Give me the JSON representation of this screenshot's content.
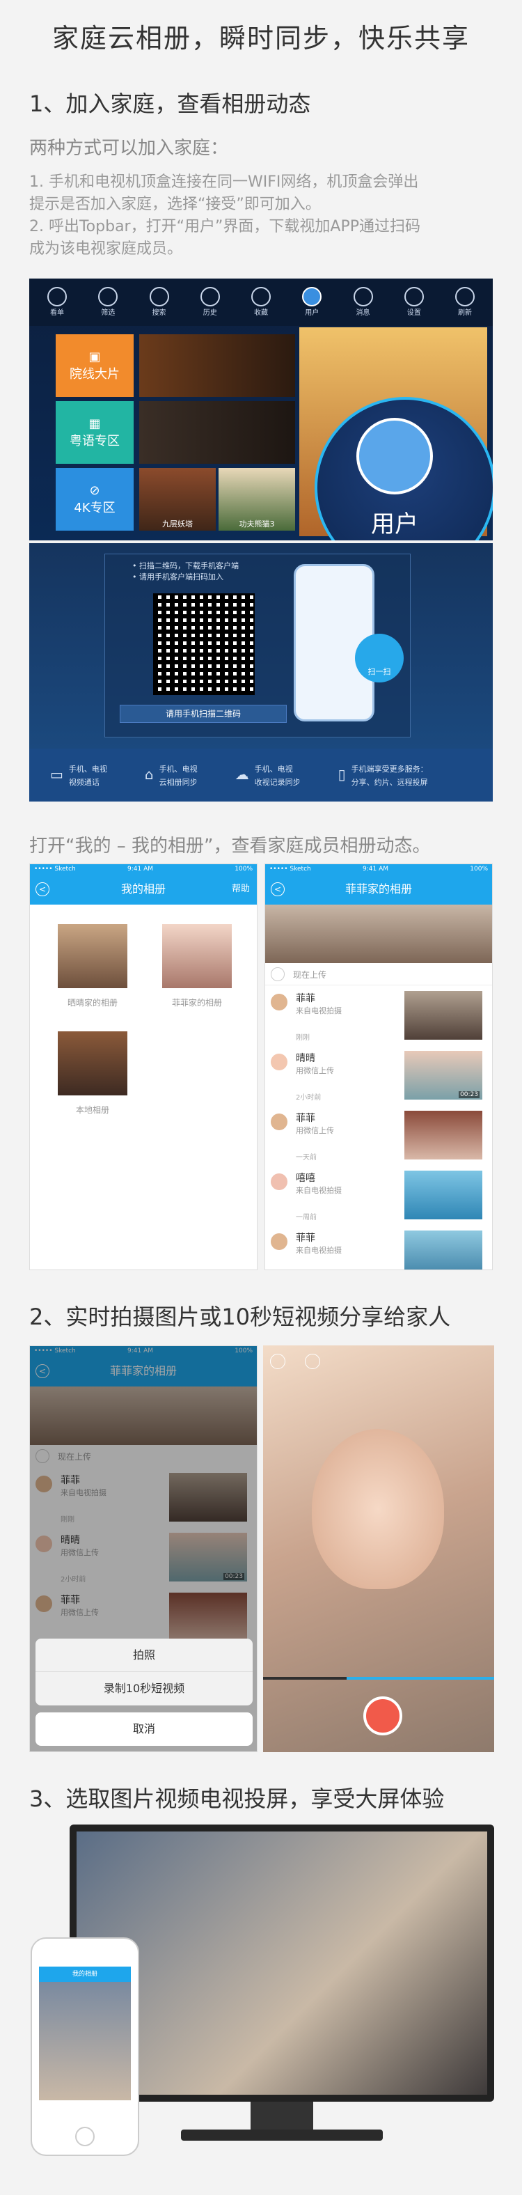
{
  "page_title": "家庭云相册，瞬时同步，快乐共享",
  "section1": {
    "title": "1、加入家庭，查看相册动态",
    "subtitle": "两种方式可以加入家庭：",
    "line1": "1. 手机和电视机顶盒连接在同一WIFI网络，机顶盒会弹出",
    "line2": "提示是否加入家庭，选择“接受”即可加入。",
    "line3": "2. 呼出Topbar，打开“用户”界面，下载视加APP通过扫码",
    "line4": "成为该电视家庭成员。",
    "tv_menu": [
      "看单",
      "筛选",
      "搜索",
      "历史",
      "收藏",
      "用户",
      "消息",
      "设置",
      "刷新"
    ],
    "tiles": [
      "院线大片",
      "粤语专区",
      "4K专区"
    ],
    "poster_captions": [
      "九层妖塔",
      "功夫熊猫3"
    ],
    "user_label": "用户",
    "qr_tip1": "• 扫描二维码，下载手机客户端",
    "qr_tip2": "• 请用手机客户端扫码加入",
    "qr_button": "请用手机扫描二维码",
    "scan_label": "扫一扫",
    "features": [
      {
        "a": "手机、电视",
        "b": "视频通话"
      },
      {
        "a": "手机、电视",
        "b": "云相册同步"
      },
      {
        "a": "手机、电视",
        "b": "收视记录同步"
      },
      {
        "a": "手机端享受更多服务：",
        "b": "分享、约片、远程投屏"
      }
    ]
  },
  "section1b": {
    "caption": "打开“我的 – 我的相册”，查看家庭成员相册动态。",
    "left_phone": {
      "status": "••••• Sketch",
      "time": "9:41 AM",
      "battery": "100%",
      "title": "我的相册",
      "help": "帮助",
      "albums": [
        "晒晴家的相册",
        "菲菲家的相册",
        "本地相册"
      ]
    },
    "right_phone": {
      "status": "••••• Sketch",
      "time": "9:41 AM",
      "battery": "100%",
      "title": "菲菲家的相册",
      "now_upload": "现在上传",
      "items": [
        {
          "name": "菲菲",
          "src": "来自电视拍摄",
          "time": "刚刚"
        },
        {
          "name": "晴晴",
          "src": "用微信上传",
          "time": "2小时前",
          "dur": "00:23"
        },
        {
          "name": "菲菲",
          "src": "用微信上传",
          "time": "一天前"
        },
        {
          "name": "嘻嘻",
          "src": "来自电视拍摄",
          "time": "一周前"
        },
        {
          "name": "菲菲",
          "src": "来自电视拍摄",
          "time": ""
        }
      ]
    }
  },
  "section2": {
    "title": "2、实时拍摄图片或10秒短视频分享给家人",
    "phone": {
      "status": "••••• Sketch",
      "time": "9:41 AM",
      "battery": "100%",
      "title": "菲菲家的相册",
      "now_upload": "现在上传",
      "items": [
        {
          "name": "菲菲",
          "src": "来自电视拍摄",
          "time": "刚刚"
        },
        {
          "name": "晴晴",
          "src": "用微信上传",
          "time": "2小时前",
          "dur": "00:23"
        },
        {
          "name": "菲菲",
          "src": "用微信上传",
          "time": ""
        }
      ],
      "sheet": {
        "photo": "拍照",
        "video": "录制10秒短视频",
        "cancel": "取消"
      }
    }
  },
  "section3": {
    "title": "3、选取图片视频电视投屏，享受大屏体验",
    "mini_title": "我的相册"
  },
  "colors": {
    "accent": "#1ea6ec",
    "record": "#f15a4a",
    "tile_orange": "#f28b2c",
    "tile_teal": "#22b5a3",
    "tile_blue": "#2b8fe0"
  }
}
